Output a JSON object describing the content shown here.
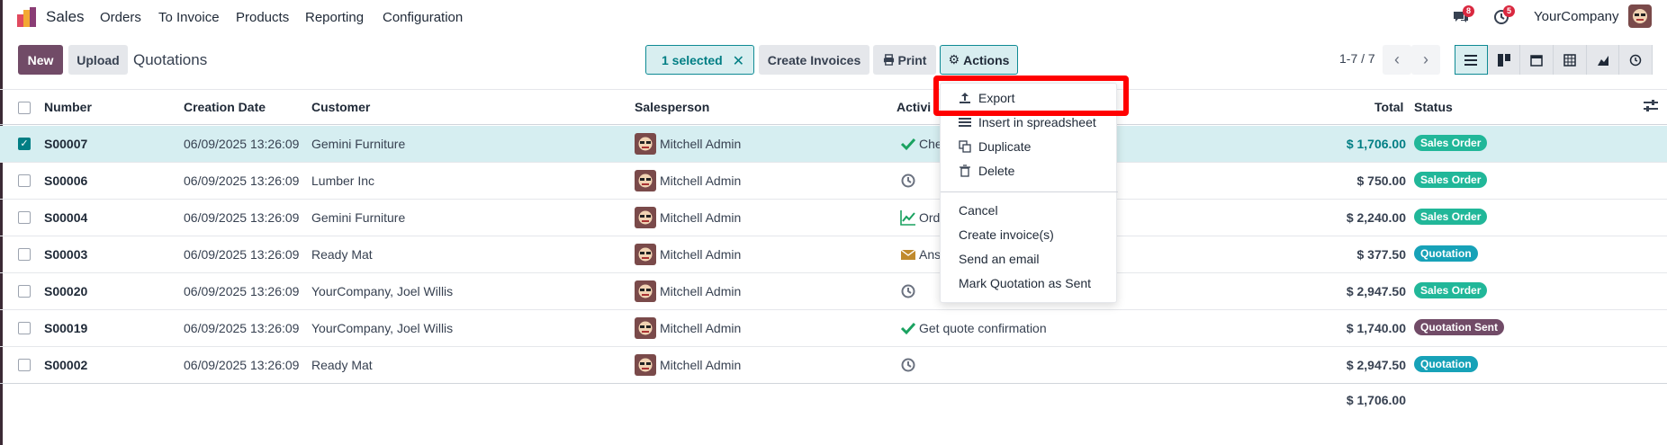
{
  "navbar": {
    "app_name": "Sales",
    "menu": [
      "Orders",
      "To Invoice",
      "Products",
      "Reporting",
      "Configuration"
    ],
    "messages_badge": "8",
    "activity_badge": "5",
    "company": "YourCompany"
  },
  "control": {
    "new_label": "New",
    "upload_label": "Upload",
    "breadcrumb": "Quotations",
    "selected_label": "1 selected",
    "create_invoices_label": "Create Invoices",
    "print_label": "Print",
    "actions_label": "Actions",
    "pager": "1-7 / 7"
  },
  "table": {
    "headers": {
      "number": "Number",
      "creation_date": "Creation Date",
      "customer": "Customer",
      "salesperson": "Salesperson",
      "activities": "Activi",
      "total": "Total",
      "status": "Status"
    },
    "rows": [
      {
        "number": "S00007",
        "date": "06/09/2025 13:26:09",
        "customer": "Gemini Furniture",
        "salesperson": "Mitchell Admin",
        "activity": "Che",
        "activity_icon": "check-icon",
        "total": "$ 1,706.00",
        "status": "Sales Order",
        "status_color": "#21b799",
        "selected": true
      },
      {
        "number": "S00006",
        "date": "06/09/2025 13:26:09",
        "customer": "Lumber Inc",
        "salesperson": "Mitchell Admin",
        "activity": "",
        "activity_icon": "clock-icon",
        "total": "$ 750.00",
        "status": "Sales Order",
        "status_color": "#21b799",
        "selected": false
      },
      {
        "number": "S00004",
        "date": "06/09/2025 13:26:09",
        "customer": "Gemini Furniture",
        "salesperson": "Mitchell Admin",
        "activity": "Ord",
        "activity_icon": "chart-icon",
        "total": "$ 2,240.00",
        "status": "Sales Order",
        "status_color": "#21b799",
        "selected": false
      },
      {
        "number": "S00003",
        "date": "06/09/2025 13:26:09",
        "customer": "Ready Mat",
        "salesperson": "Mitchell Admin",
        "activity": "Ans",
        "activity_icon": "envelope-icon",
        "total": "$ 377.50",
        "status": "Quotation",
        "status_color": "#17a2b8",
        "selected": false
      },
      {
        "number": "S00020",
        "date": "06/09/2025 13:26:09",
        "customer": "YourCompany, Joel Willis",
        "salesperson": "Mitchell Admin",
        "activity": "",
        "activity_icon": "clock-icon",
        "total": "$ 2,947.50",
        "status": "Sales Order",
        "status_color": "#21b799",
        "selected": false
      },
      {
        "number": "S00019",
        "date": "06/09/2025 13:26:09",
        "customer": "YourCompany, Joel Willis",
        "salesperson": "Mitchell Admin",
        "activity": "Get quote confirmation",
        "activity_icon": "check-icon",
        "total": "$ 1,740.00",
        "status": "Quotation Sent",
        "status_color": "#714b67",
        "selected": false
      },
      {
        "number": "S00002",
        "date": "06/09/2025 13:26:09",
        "customer": "Ready Mat",
        "salesperson": "Mitchell Admin",
        "activity": "",
        "activity_icon": "clock-icon",
        "total": "$ 2,947.50",
        "status": "Quotation",
        "status_color": "#17a2b8",
        "selected": false
      }
    ],
    "footer_total": "$ 1,706.00"
  },
  "actions_menu": {
    "export": "Export",
    "insert_spreadsheet": "Insert in spreadsheet",
    "duplicate": "Duplicate",
    "delete": "Delete",
    "cancel": "Cancel",
    "create_invoices": "Create invoice(s)",
    "send_email": "Send an email",
    "mark_sent": "Mark Quotation as Sent"
  }
}
